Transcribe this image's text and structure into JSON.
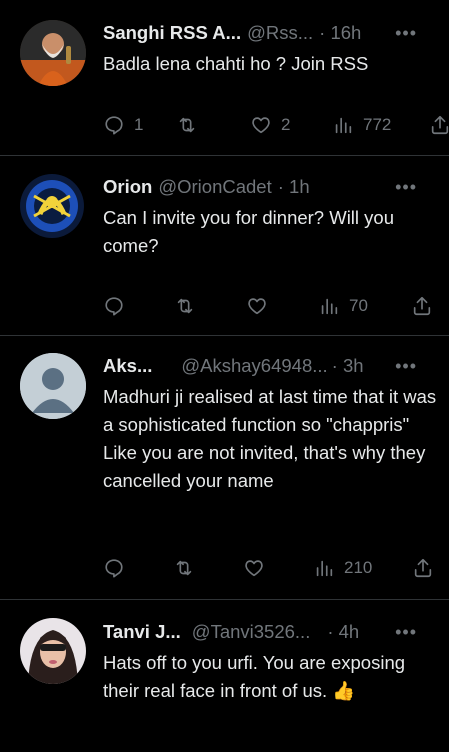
{
  "tweets": [
    {
      "name": "Sanghi RSS A...",
      "handle": "@Rss...",
      "time": "· 16h",
      "text": "Badla lena chahti ho ? Join RSS",
      "replies": "1",
      "retweets": "",
      "likes": "2",
      "views": "772"
    },
    {
      "name": "Orion",
      "handle": "@OrionCadet",
      "time": "· 1h",
      "text": "Can I invite you for dinner? Will you come?",
      "replies": "",
      "retweets": "",
      "likes": "",
      "views": "70"
    },
    {
      "name": "Aks...",
      "handle": "@Akshay64948...",
      "time": "· 3h",
      "text": "Madhuri ji realised at last time that it was a sophisticated function so \"chappris\" Like you are not invited, that's why they cancelled your name",
      "replies": "",
      "retweets": "",
      "likes": "",
      "views": "210"
    },
    {
      "name": "Tanvi J...",
      "handle": "@Tanvi3526...",
      "time": "· 4h",
      "text": "Hats off to you urfi. You are exposing their real face in front of us. 👍"
    }
  ],
  "icons": {
    "reply": "reply-icon",
    "retweet": "retweet-icon",
    "like": "heart-icon",
    "views": "views-icon",
    "share": "share-icon",
    "more": "more-icon"
  },
  "colors": {
    "background": "#000000",
    "text": "#e7e9ea",
    "secondary": "#71767b",
    "divider": "#2f3336"
  },
  "more_glyph": "•••"
}
